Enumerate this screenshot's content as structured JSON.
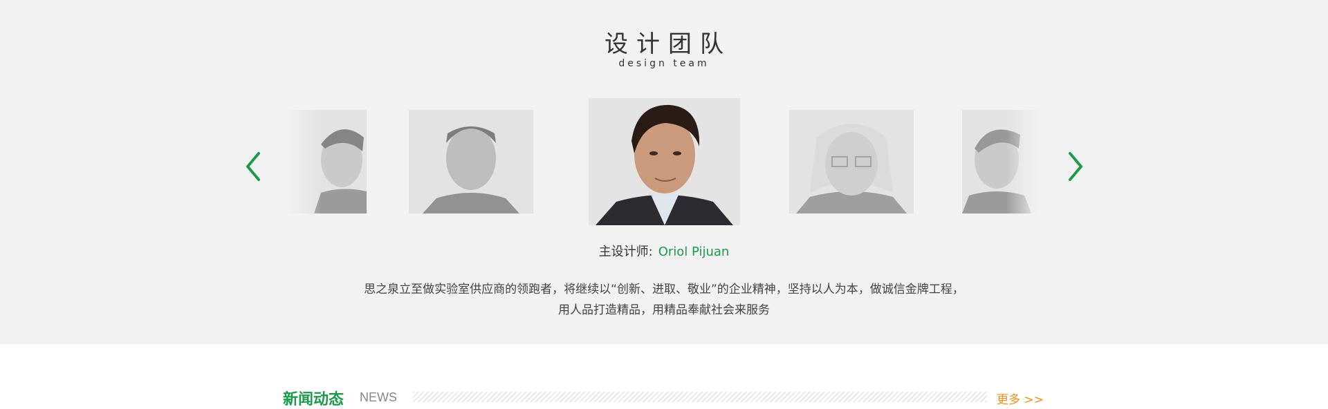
{
  "team": {
    "title": "设计团队",
    "subtitle": "design team",
    "designer_label": "主设计师:",
    "designer_name": "Oriol Pijuan",
    "description_line1": "思之泉立至做实验室供应商的领跑者，将继续以“创新、进取、敬业”的企业精神，坚持以人为本，做诚信金牌工程，",
    "description_line2": "用人品打造精品，用精品奉献社会来服务"
  },
  "news": {
    "title": "新闻动态",
    "title_en": "NEWS",
    "more": "更多 >>"
  },
  "colors": {
    "accent": "#1b9a4a",
    "more": "#f08f1e",
    "section_bg": "#f2f2f2"
  },
  "icons": {
    "prev": "chevron-left-icon",
    "next": "chevron-right-icon"
  }
}
